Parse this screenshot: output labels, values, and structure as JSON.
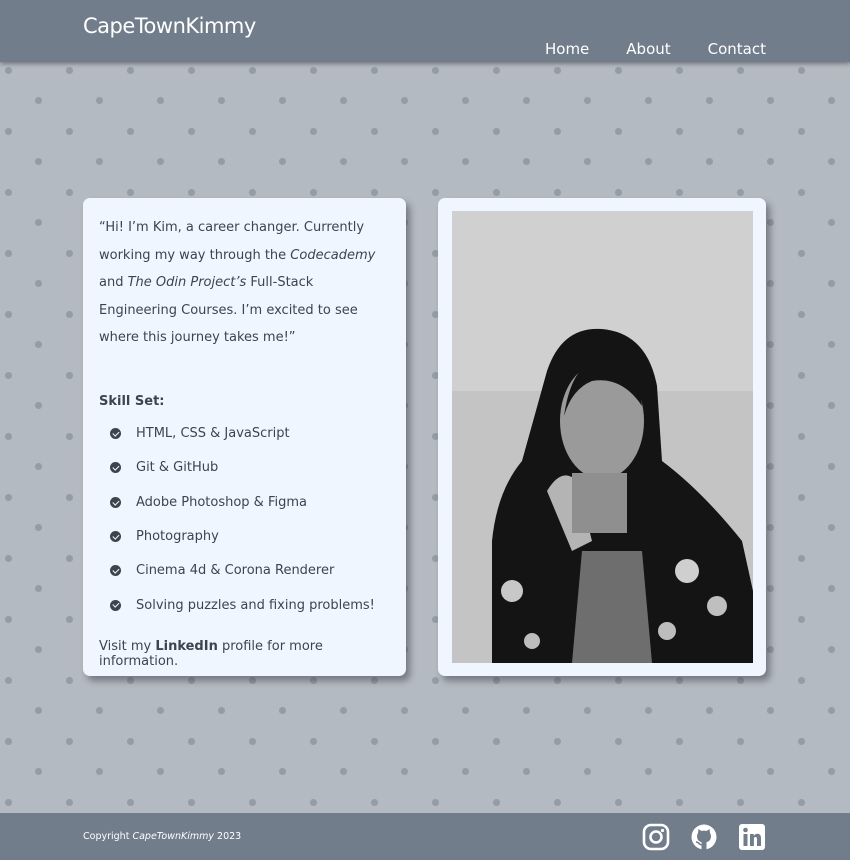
{
  "header": {
    "brand": "CapeTownKimmy",
    "nav": [
      "Home",
      "About",
      "Contact"
    ]
  },
  "about": {
    "quote_parts": [
      "“Hi! I’m Kim, a career changer. Currently working my way through the ",
      "Codecademy",
      " and ",
      "The Odin Project’s",
      " Full-Stack Engineering Courses. I’m excited to see where this journey takes me!”"
    ],
    "skills_title": "Skill Set:",
    "skills": [
      "HTML, CSS & JavaScript",
      "Git & GitHub",
      "Adobe Photoshop & Figma",
      "Photography",
      "Cinema 4d & Corona Renderer",
      "Solving puzzles and fixing problems!"
    ],
    "visit_prefix": "Visit my ",
    "visit_link": "LinkedIn",
    "visit_suffix": " profile for more information."
  },
  "footer": {
    "copy_prefix": "Copyright ",
    "copy_brand": "CapeTownKimmy",
    "copy_year": " 2023",
    "social_icons": [
      "instagram-icon",
      "github-icon",
      "linkedin-icon"
    ]
  },
  "colors": {
    "header_bg": "#717d8b",
    "page_bg": "#b4bac1",
    "card_bg": "#eff6ff",
    "text": "#3d444c"
  }
}
